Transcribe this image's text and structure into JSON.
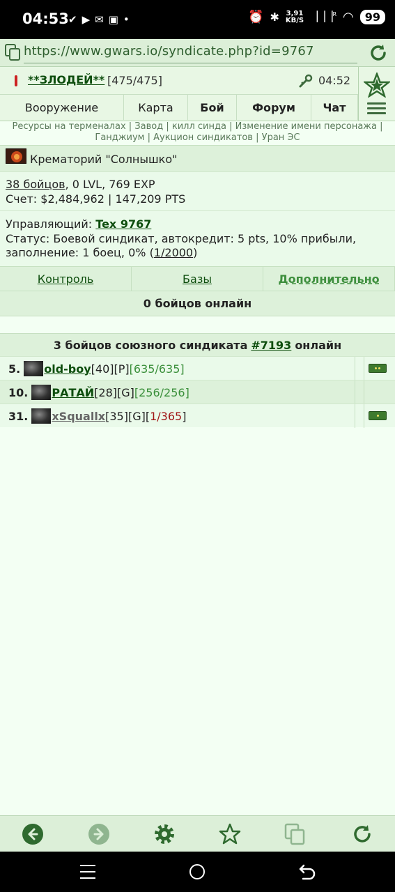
{
  "status_bar": {
    "time": "04:53",
    "net_speed_value": "3,91",
    "net_speed_unit": "KB/S",
    "battery": "99",
    "signal_label": "R"
  },
  "url_bar": {
    "url": "https://www.gwars.io/syndicate.php?id=9767"
  },
  "header": {
    "player_name": "**ЗЛОДЕЙ**",
    "hp": "[475/475]",
    "clock": "04:52",
    "nav": [
      "Вооружение",
      "Карта",
      "Бой",
      "Форум",
      "Чат"
    ]
  },
  "links": [
    "Ресурсы на терменалах",
    "Завод",
    "килл синда",
    "Изменение имени персонажа",
    "Ганджиум",
    "Аукцион синдикатов",
    "Уран ЭС"
  ],
  "syndicate": {
    "name": "Крематорий \"Солнышко\"",
    "fighters_link": "38 бойцов",
    "stats": ", 0 LVL, 769 EXP",
    "account": "Счет: $2,484,962 | 147,209 PTS",
    "manager_label": "Управляющий:",
    "manager_name": "Tex 9767",
    "status_text": "Статус: Боевой синдикат, автокредит: 5 pts, 10% прибыли, заполнение: 1 боец, 0% (",
    "status_link": "1/2000",
    "status_close": ")"
  },
  "tabs": [
    "Контроль",
    "Базы",
    "Дополнительно"
  ],
  "online": {
    "text": "0 бойцов онлайн"
  },
  "allies": {
    "head_before": "3 бойцов союзного синдиката",
    "head_link": "#7193",
    "head_after": "онлайн",
    "rows": [
      {
        "num": "5.",
        "name": "old-boy",
        "level": "[40]",
        "faction": "[P]",
        "hp": "[635/635]"
      },
      {
        "num": "10.",
        "name": "РАТАЙ",
        "level": "[28]",
        "faction": "[G]",
        "hp": "[256/256]"
      },
      {
        "num": "31.",
        "name": "xSquallx",
        "level": "[35]",
        "faction": "[G]",
        "hp_open": "[",
        "hp_value": "1/365",
        "hp_close": "]"
      }
    ]
  },
  "icons": {
    "copy": "copy-icon",
    "reload": "reload-icon",
    "wrench": "wrench-icon",
    "star": "star-icon",
    "menu": "hamburger-icon",
    "back": "arrow-left-icon",
    "forward": "arrow-right-icon",
    "settings": "gear-icon",
    "bookmark": "star-outline-icon",
    "tabs": "tabs-icon"
  },
  "colors": {
    "accent_dark": "#0d4d0d",
    "accent_green": "#3e8f3e",
    "hp_low": "#a01515",
    "page_bg": "#f3fff3",
    "row_bg": "#ddf1da"
  }
}
